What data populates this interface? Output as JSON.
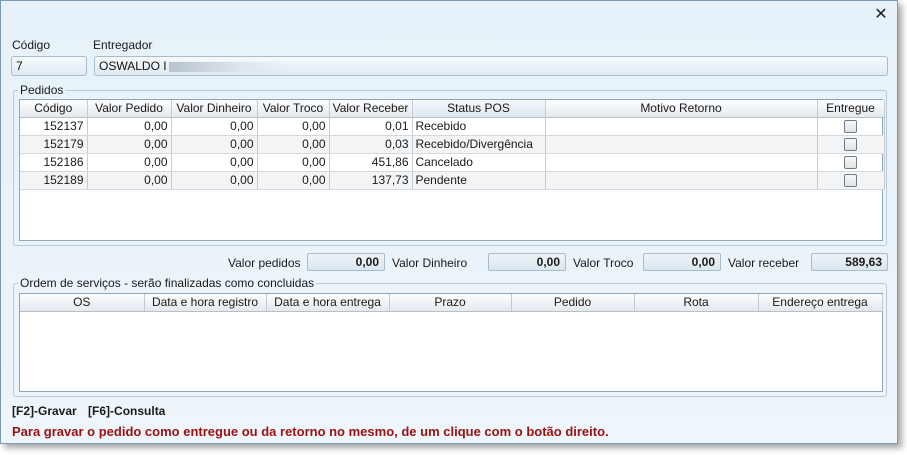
{
  "window": {
    "close_glyph": "✕",
    "close_icon": "close-icon"
  },
  "header": {
    "codigo_label": "Código",
    "codigo_value": "7",
    "entregador_label": "Entregador",
    "entregador_value": "OSWALDO I"
  },
  "pedidos": {
    "group_label": "Pedidos",
    "columns": [
      "Código",
      "Valor Pedido",
      "Valor Dinheiro",
      "Valor Troco",
      "Valor Receber",
      "Status POS",
      "Motivo Retorno",
      "Entregue"
    ],
    "rows": [
      {
        "codigo": "152137",
        "valor_pedido": "0,00",
        "valor_dinheiro": "0,00",
        "valor_troco": "0,00",
        "valor_receber": "0,01",
        "status_pos": "Recebido",
        "motivo_retorno": "",
        "entregue": false
      },
      {
        "codigo": "152179",
        "valor_pedido": "0,00",
        "valor_dinheiro": "0,00",
        "valor_troco": "0,00",
        "valor_receber": "0,03",
        "status_pos": "Recebido/Divergência",
        "motivo_retorno": "",
        "entregue": false
      },
      {
        "codigo": "152186",
        "valor_pedido": "0,00",
        "valor_dinheiro": "0,00",
        "valor_troco": "0,00",
        "valor_receber": "451,86",
        "status_pos": "Cancelado",
        "motivo_retorno": "",
        "entregue": false
      },
      {
        "codigo": "152189",
        "valor_pedido": "0,00",
        "valor_dinheiro": "0,00",
        "valor_troco": "0,00",
        "valor_receber": "137,73",
        "status_pos": "Pendente",
        "motivo_retorno": "",
        "entregue": false
      }
    ]
  },
  "totals": {
    "valor_pedidos_label": "Valor pedidos",
    "valor_pedidos": "0,00",
    "valor_dinheiro_label": "Valor Dinheiro",
    "valor_dinheiro": "0,00",
    "valor_troco_label": "Valor Troco",
    "valor_troco": "0,00",
    "valor_receber_label": "Valor receber",
    "valor_receber": "589,63"
  },
  "ordens": {
    "group_label": "Ordem de serviços - serão finalizadas como concluidas",
    "columns": [
      "OS",
      "Data e hora registro",
      "Data e hora entrega",
      "Prazo",
      "Pedido",
      "Rota",
      "Endereço entrega"
    ]
  },
  "footer": {
    "gravar": "[F2]-Gravar",
    "consulta": "[F6]-Consulta",
    "warning": "Para gravar o pedido como entregue ou da retorno no mesmo, de um clique com o botão direito.",
    "warning_color": "#9c1010"
  }
}
